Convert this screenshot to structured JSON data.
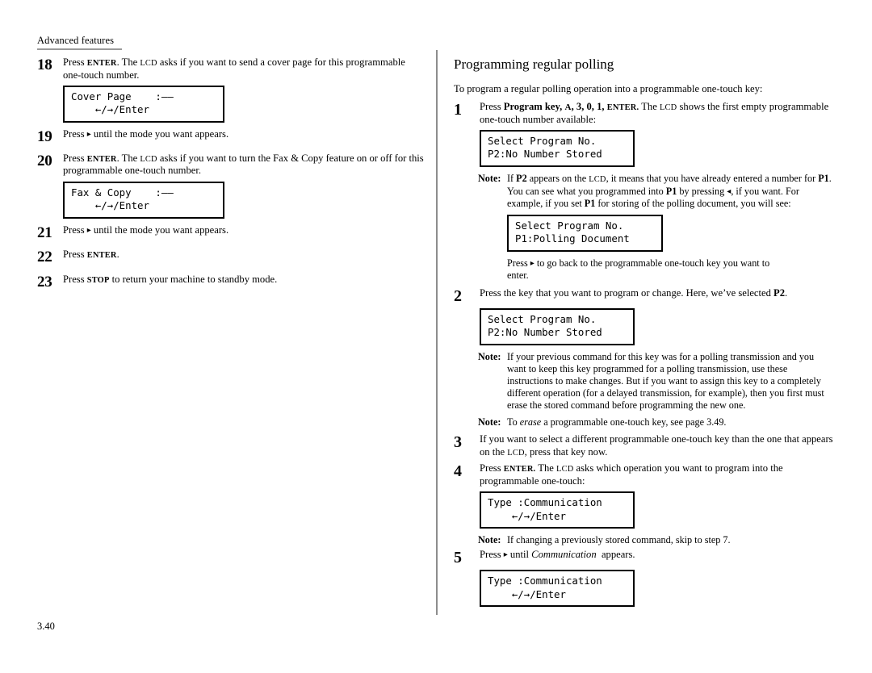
{
  "page": {
    "running_header": "Advanced features",
    "folio": "3.40"
  },
  "left_column": {
    "steps": [
      {
        "number": "18",
        "text_segments": [
          {
            "t": "Press ",
            "style": "normal"
          },
          {
            "t": "ENTER",
            "style": "smallcaps-bold"
          },
          {
            "t": ". The ",
            "style": "normal"
          },
          {
            "t": "LCD",
            "style": "smallcaps"
          },
          {
            "t": " asks if you want to send a cover page for this programmable one-touch number.",
            "style": "normal"
          }
        ],
        "plain_text": "Press ENTER. The LCD asks if you want to send a cover page for this programmable one-touch number.",
        "lcd": {
          "line1": "Cover Page    :——",
          "line2": "    ←/→/Enter"
        }
      },
      {
        "number": "19",
        "plain_text": "Press ▸ until the mode you want appears.",
        "lcd": null
      },
      {
        "number": "20",
        "plain_text": "Press ENTER. The LCD asks if you want to turn the Fax & Copy feature on or off for this programmable one-touch number.",
        "lcd": {
          "line1": "Fax & Copy    :——",
          "line2": "    ←/→/Enter"
        }
      },
      {
        "number": "21",
        "plain_text": "Press ▸ until the mode you want appears.",
        "lcd": null
      },
      {
        "number": "22",
        "plain_text": "Press ENTER.",
        "lcd": null
      },
      {
        "number": "23",
        "plain_text": "Press STOP to return your machine to standby mode.",
        "lcd": null
      }
    ]
  },
  "right_column": {
    "heading": "Programming regular polling",
    "intro": "To program a regular polling operation into a programmable one-touch key:",
    "step1": {
      "number": "1",
      "lead": "Press ",
      "bold_keys": "Program key,",
      "bold_a": "A",
      "bold_mid": ", 3, 0, 1, ",
      "bold_enter": "ENTER.",
      "tail_1": " The ",
      "lcd_word": "LCD",
      "tail_2": " shows the first empty programmable one-touch number available:",
      "lcd": {
        "line1": "Select Program No.",
        "line2": "P2:No Number Stored"
      }
    },
    "note1": {
      "label": "Note:",
      "seg1": "If ",
      "b1": "P2",
      "seg2": " appears on the ",
      "sc1": "LCD",
      "seg3": ", it means that you have already entered a number for ",
      "b2": "P1",
      "seg4": ". You can see what you programmed into ",
      "b3": "P1",
      "seg5": " by pressing ◂, if you want. For example, if you set ",
      "b4": "P1",
      "seg6": " for storing of the polling document, you will see:",
      "lcd": {
        "line1": "Select Program No.",
        "line2": "P1:Polling Document"
      },
      "after": "Press ▸ to go back to the programmable one-touch key you want to enter."
    },
    "step2": {
      "number": "2",
      "seg1": "Press the key that you want to program or change. Here, we’ve selected ",
      "b1": "P2",
      "seg2": ".",
      "lcd": {
        "line1": "Select Program No.",
        "line2": "P2:No Number Stored"
      }
    },
    "note2": {
      "label": "Note:",
      "text": "If your previous command for this key was for a polling transmission and you want to keep this key programmed for a polling transmission, use these instructions to make changes. But if you want to assign this key to a completely different operation (for a delayed transmission, for example), then you first must erase the stored command before programming the new one."
    },
    "note3": {
      "label": "Note:",
      "seg1": "To ",
      "i1": "erase",
      "seg2": " a programmable one-touch key, see page 3.49."
    },
    "step3": {
      "number": "3",
      "seg1": "If you want to select a different programmable one-touch key than the one that appears on the ",
      "sc1": "LCD",
      "seg2": ", press that key now."
    },
    "step4": {
      "number": "4",
      "seg1": "Press ",
      "sc1": "ENTER.",
      "seg2": " The ",
      "sc2": "LCD",
      "seg3": " asks which operation you want to program into the programmable one-touch:",
      "lcd": {
        "line1": "Type :Communication",
        "line2": "    ←/→/Enter"
      }
    },
    "note4": {
      "label": "Note:",
      "text": "If changing a previously stored command, skip to step 7."
    },
    "step5": {
      "number": "5",
      "seg1": "Press ▸ until ",
      "i1": "Communication",
      "seg2": "  appears.",
      "lcd": {
        "line1": "Type :Communication",
        "line2": "    ←/→/Enter"
      }
    }
  }
}
